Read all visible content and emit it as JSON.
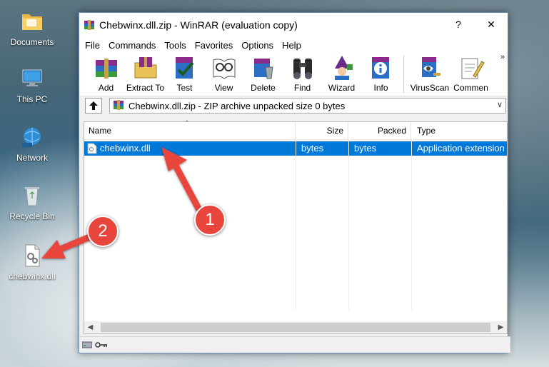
{
  "desktop": {
    "icons": [
      {
        "label": "Documents"
      },
      {
        "label": "This PC"
      },
      {
        "label": "Network"
      },
      {
        "label": "Recycle Bin"
      },
      {
        "label": "chebwinx.dll"
      }
    ]
  },
  "window": {
    "title": "Chebwinx.dll.zip - WinRAR (evaluation copy)",
    "help_glyph": "?",
    "close_glyph": "✕"
  },
  "menu": [
    "File",
    "Commands",
    "Tools",
    "Favorites",
    "Options",
    "Help"
  ],
  "toolbar": {
    "items": [
      {
        "label": "Add",
        "icon": "add-icon"
      },
      {
        "label": "Extract To",
        "icon": "extract-icon"
      },
      {
        "label": "Test",
        "icon": "test-icon"
      },
      {
        "label": "View",
        "icon": "view-icon"
      },
      {
        "label": "Delete",
        "icon": "delete-icon"
      },
      {
        "label": "Find",
        "icon": "find-icon"
      },
      {
        "label": "Wizard",
        "icon": "wizard-icon"
      },
      {
        "label": "Info",
        "icon": "info-icon"
      },
      {
        "label": "VirusScan",
        "icon": "virusscan-icon"
      },
      {
        "label": "Commen",
        "icon": "comment-icon"
      }
    ],
    "overflow": "»"
  },
  "address": {
    "path": "Chebwinx.dll.zip - ZIP archive unpacked size 0 bytes"
  },
  "filelist": {
    "columns": {
      "name": "Name",
      "size": "Size",
      "packed": "Packed",
      "type": "Type"
    },
    "rows": [
      {
        "name": "chebwinx.dll",
        "size": "bytes",
        "packed": "bytes",
        "type": "Application extension",
        "selected": true
      }
    ]
  },
  "annotations": {
    "badge1": "1",
    "badge2": "2",
    "color": "#e8453c"
  }
}
